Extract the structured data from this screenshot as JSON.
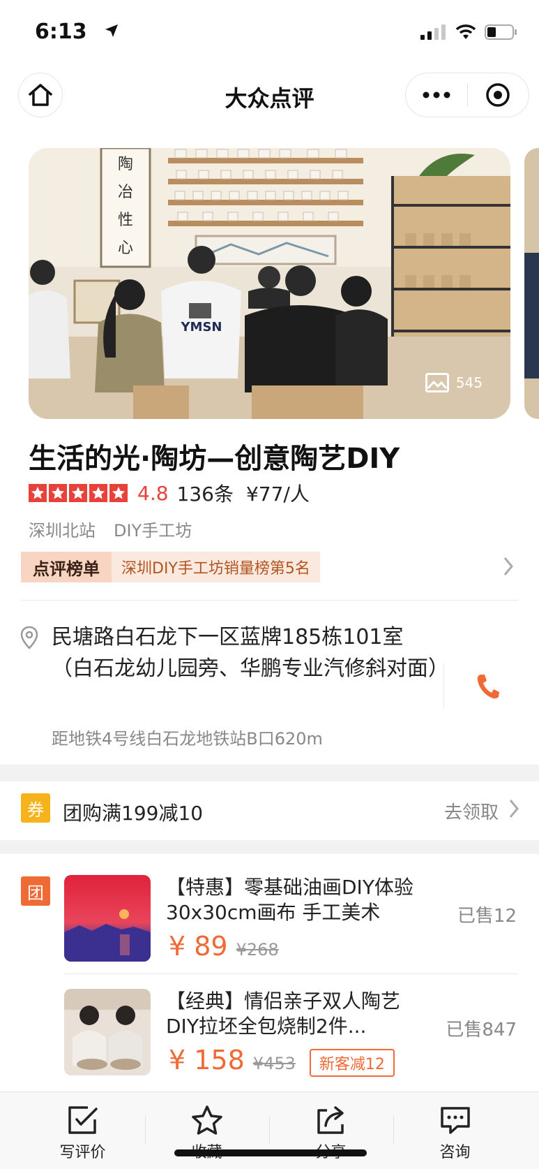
{
  "status_bar": {
    "time": "6:13"
  },
  "nav": {
    "title": "大众点评"
  },
  "hero": {
    "photo_count": "545"
  },
  "shop": {
    "name": "生活的光·陶坊—创意陶艺DIY",
    "rating": "4.8",
    "rating_stars": 5,
    "review_count": "136条",
    "avg_price": "¥77/人",
    "tags": [
      "深圳北站",
      "DIY手工坊"
    ],
    "rank_badge": "点评榜单",
    "rank_text": "深圳DIY手工坊销量榜第5名"
  },
  "address": {
    "text": "民塘路白石龙下一区蓝牌185栋101室（白石龙幼儿园旁、华鹏专业汽修斜对面）",
    "distance": "距地铁4号线白石龙地铁站B口620m"
  },
  "coupon": {
    "icon_label": "券",
    "text": "团购满199减10",
    "action": "去领取"
  },
  "deals_section": {
    "icon_label": "团"
  },
  "deals": [
    {
      "title": "【特惠】零基础油画DIY体验30x30cm画布 手工美术",
      "price": "¥ 89",
      "original_price": "¥268",
      "promo": "",
      "sold": "已售12"
    },
    {
      "title": "【经典】情侣亲子双人陶艺DIY拉坯全包烧制2件...",
      "price": "¥ 158",
      "original_price": "¥453",
      "promo": "新客减12",
      "sold": "已售847"
    }
  ],
  "tabbar": {
    "tabs": [
      {
        "label": "写评价",
        "icon": "write-review-icon"
      },
      {
        "label": "收藏",
        "icon": "star-icon"
      },
      {
        "label": "分享",
        "icon": "share-icon"
      },
      {
        "label": "咨询",
        "icon": "chat-icon"
      }
    ]
  },
  "colors": {
    "accent_red": "#e8413a",
    "accent_orange": "#f06a35",
    "coupon_yellow": "#f7b31b",
    "rank_text": "#b2541f"
  }
}
